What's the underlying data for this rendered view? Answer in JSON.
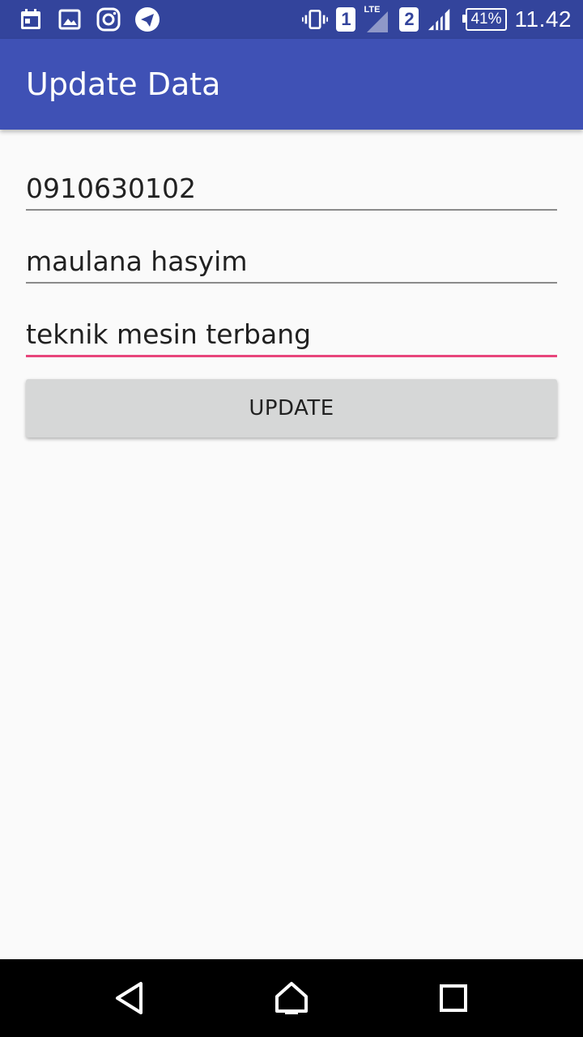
{
  "status_bar": {
    "left_icons": [
      "calendar-icon",
      "image-icon",
      "instagram-icon",
      "telegram-icon"
    ],
    "vibrate_icon": "vibrate-icon",
    "sim1_label": "1",
    "lte_label": "LTE",
    "sim2_label": "2",
    "battery_label": "41%",
    "time": "11.42"
  },
  "app_bar": {
    "title": "Update Data"
  },
  "form": {
    "id_value": "0910630102",
    "name_value": "maulana hasyim",
    "major_value": "teknik mesin terbang",
    "update_label": "UPDATE"
  },
  "nav_bar": {
    "icons": [
      "back-icon",
      "home-icon",
      "recents-icon"
    ]
  },
  "colors": {
    "status_bar": "#33449c",
    "app_bar": "#3f51b5",
    "accent": "#e8457b",
    "background": "#fafafa",
    "button": "#d6d7d7"
  }
}
